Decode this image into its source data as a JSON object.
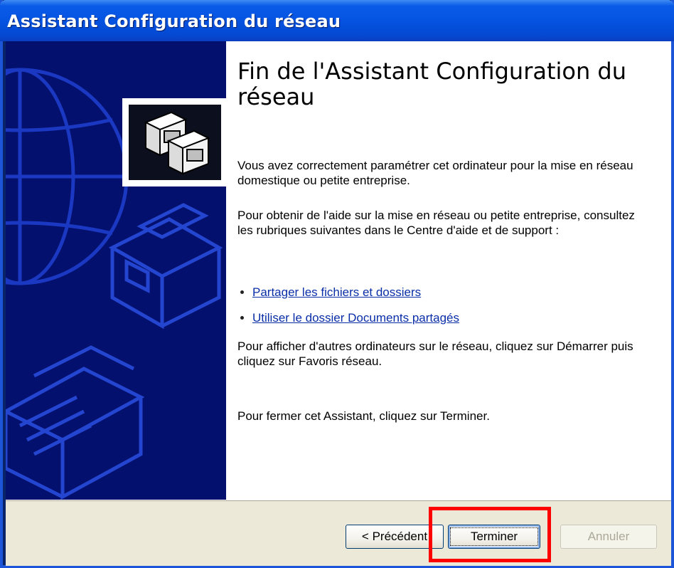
{
  "window": {
    "title": "Assistant Configuration du réseau"
  },
  "wizard": {
    "heading": "Fin de l'Assistant Configuration du réseau",
    "paragraph_1": "Vous avez correctement paramétrer cet ordinateur pour la mise en réseau domestique ou petite entreprise.",
    "paragraph_2": "Pour obtenir de l'aide sur la mise en réseau ou petite entreprise, consultez les rubriques suivantes dans le Centre d'aide et de support :",
    "links": [
      "Partager les fichiers et dossiers",
      "Utiliser le dossier Documents partagés"
    ],
    "paragraph_3": "Pour afficher d'autres ordinateurs sur le réseau, cliquez sur Démarrer puis cliquez sur Favoris réseau.",
    "paragraph_4": "Pour fermer cet Assistant, cliquez sur Terminer."
  },
  "buttons": {
    "back": "< Précédent",
    "finish": "Terminer",
    "cancel": "Annuler"
  },
  "icons": {
    "header": "network-computers-icon",
    "sidebar": "network-globe-illustration"
  },
  "colors": {
    "titlebar": "#0553e1",
    "sidebar": "#04106e",
    "link": "#0a2ea8",
    "highlight": "#ff0000"
  }
}
